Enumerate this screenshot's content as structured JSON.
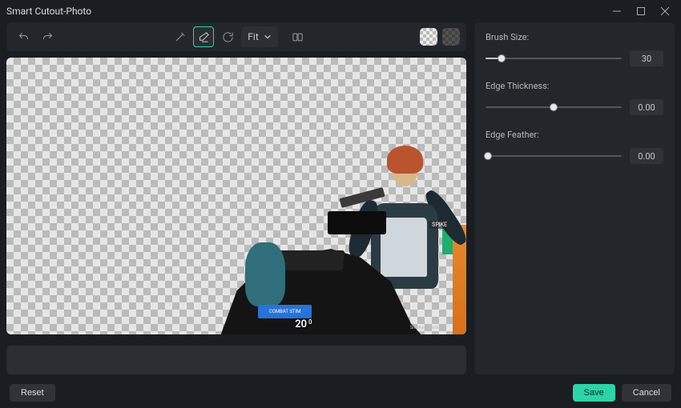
{
  "window": {
    "title": "Smart Cutout-Photo"
  },
  "toolbar": {
    "zoom_label": "Fit"
  },
  "hud": {
    "combat_stim": "COMBAT STIM",
    "ammo": "20",
    "ammo_sub": "0",
    "spike": "SPIKE",
    "player": "Sir Magmamax"
  },
  "panel": {
    "brush_size": {
      "label": "Brush Size:",
      "value": "30",
      "pct": 12
    },
    "edge_thickness": {
      "label": "Edge Thickness:",
      "value": "0.00",
      "pct": 50
    },
    "edge_feather": {
      "label": "Edge Feather:",
      "value": "0.00",
      "pct": 2
    }
  },
  "footer": {
    "reset": "Reset",
    "save": "Save",
    "cancel": "Cancel"
  }
}
